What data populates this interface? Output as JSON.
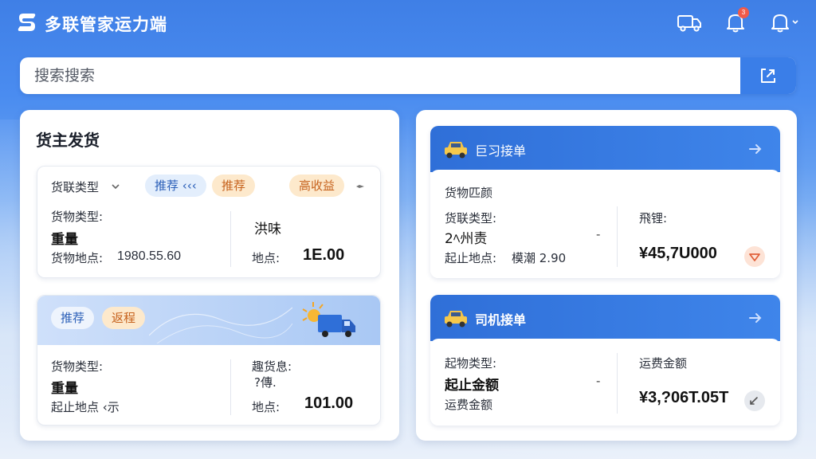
{
  "app": {
    "title": "多联管家运力端",
    "notification_count": "3"
  },
  "search": {
    "placeholder": "搜索搜索"
  },
  "left_panel": {
    "title": "货主发货",
    "card1": {
      "dropdown_label": "货联类型",
      "tags": [
        "推荐 ‹‹‹",
        "推荐",
        "高收益"
      ],
      "cargo_type_label": "货物类型:",
      "cargo_type_value": "重量",
      "location_label": "货物地点:",
      "location_value": "1980.55.60",
      "right_label": "洪味",
      "right_loc_label": "地点:",
      "right_value": "1E.00"
    },
    "card2": {
      "tags": [
        "推荐",
        "返程"
      ],
      "cargo_type_label": "货物类型:",
      "cargo_type_value": "重量",
      "route_label": "起止地点 ‹示",
      "right_label": "趣货息:",
      "right_sub": "?傳.",
      "right_loc_label": "地点:",
      "right_value": "101.00"
    }
  },
  "right_panel": {
    "card1": {
      "header_title": "巨习接单",
      "goods_label": "货物匹颜",
      "cargo_type_label": "货联类型:",
      "cargo_type_value": "2ﾍ州责",
      "route_label": "起止地点:",
      "route_value": "模潮 2.90",
      "dash": "-",
      "fee_label": "飛锂:",
      "fee_value": "¥45,7U000"
    },
    "card2": {
      "header_title": "司机接单",
      "cargo_type_label": "起物类型:",
      "cargo_type_value": "起止金额",
      "fee_sub_label": "运费金额",
      "dash": "-",
      "fee_label": "运费金额",
      "fee_value": "¥3,?06T.05T"
    }
  },
  "colors": {
    "primary": "#3a7ee8",
    "tag_blue_bg": "#e3eefc",
    "tag_orange_bg": "#fde9cc",
    "badge": "#f05a4a"
  },
  "icons": [
    "logo-icon",
    "truck-icon",
    "bell-icon",
    "bell-dropdown-icon",
    "export-icon",
    "car-icon",
    "arrow-right-icon",
    "chevron-down-icon",
    "more-icon",
    "delivery-truck-illustration",
    "check-badge-icon",
    "edit-icon"
  ]
}
